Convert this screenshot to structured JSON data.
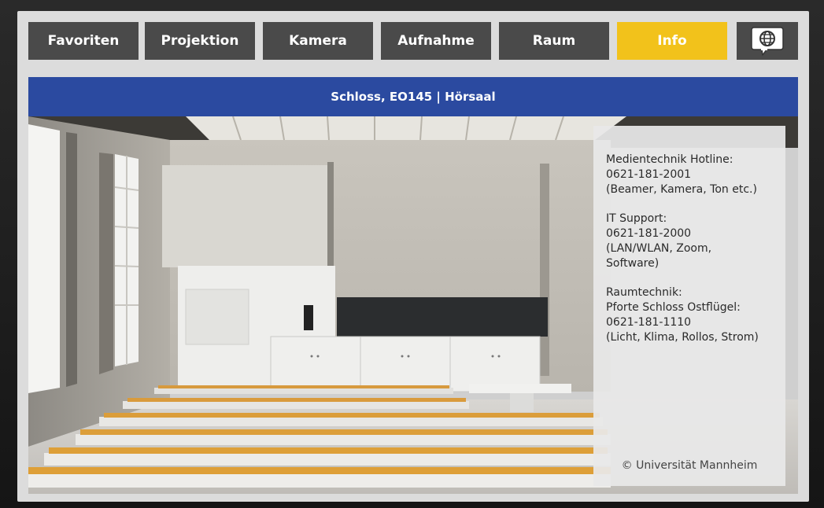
{
  "nav": {
    "tabs": [
      {
        "label": "Favoriten"
      },
      {
        "label": "Projektion"
      },
      {
        "label": "Kamera"
      },
      {
        "label": "Aufnahme"
      },
      {
        "label": "Raum"
      },
      {
        "label": "Info"
      }
    ],
    "active_tab": "Info",
    "language_icon": "globe-speech-bubble-icon"
  },
  "header": {
    "title": "Schloss, EO145 | Hörsaal"
  },
  "info": {
    "media": {
      "title": "Medientechnik Hotline:",
      "phone": "0621-181-2001",
      "note": "(Beamer, Kamera, Ton etc.)"
    },
    "it": {
      "title": "IT Support:",
      "phone": "0621-181-2000",
      "note1": "(LAN/WLAN, Zoom,",
      "note2": "Software)"
    },
    "room": {
      "title": "Raumtechnik:",
      "sub": "Pforte Schloss Ostflügel:",
      "phone": "0621-181-1110",
      "note": "(Licht, Klima, Rollos, Strom)"
    },
    "copyright": "© Universität Mannheim"
  },
  "colors": {
    "nav_button": "#4a4a4a",
    "nav_active": "#f2c21b",
    "title_bar": "#2b4aa0",
    "panel": "#e8e8e8"
  }
}
